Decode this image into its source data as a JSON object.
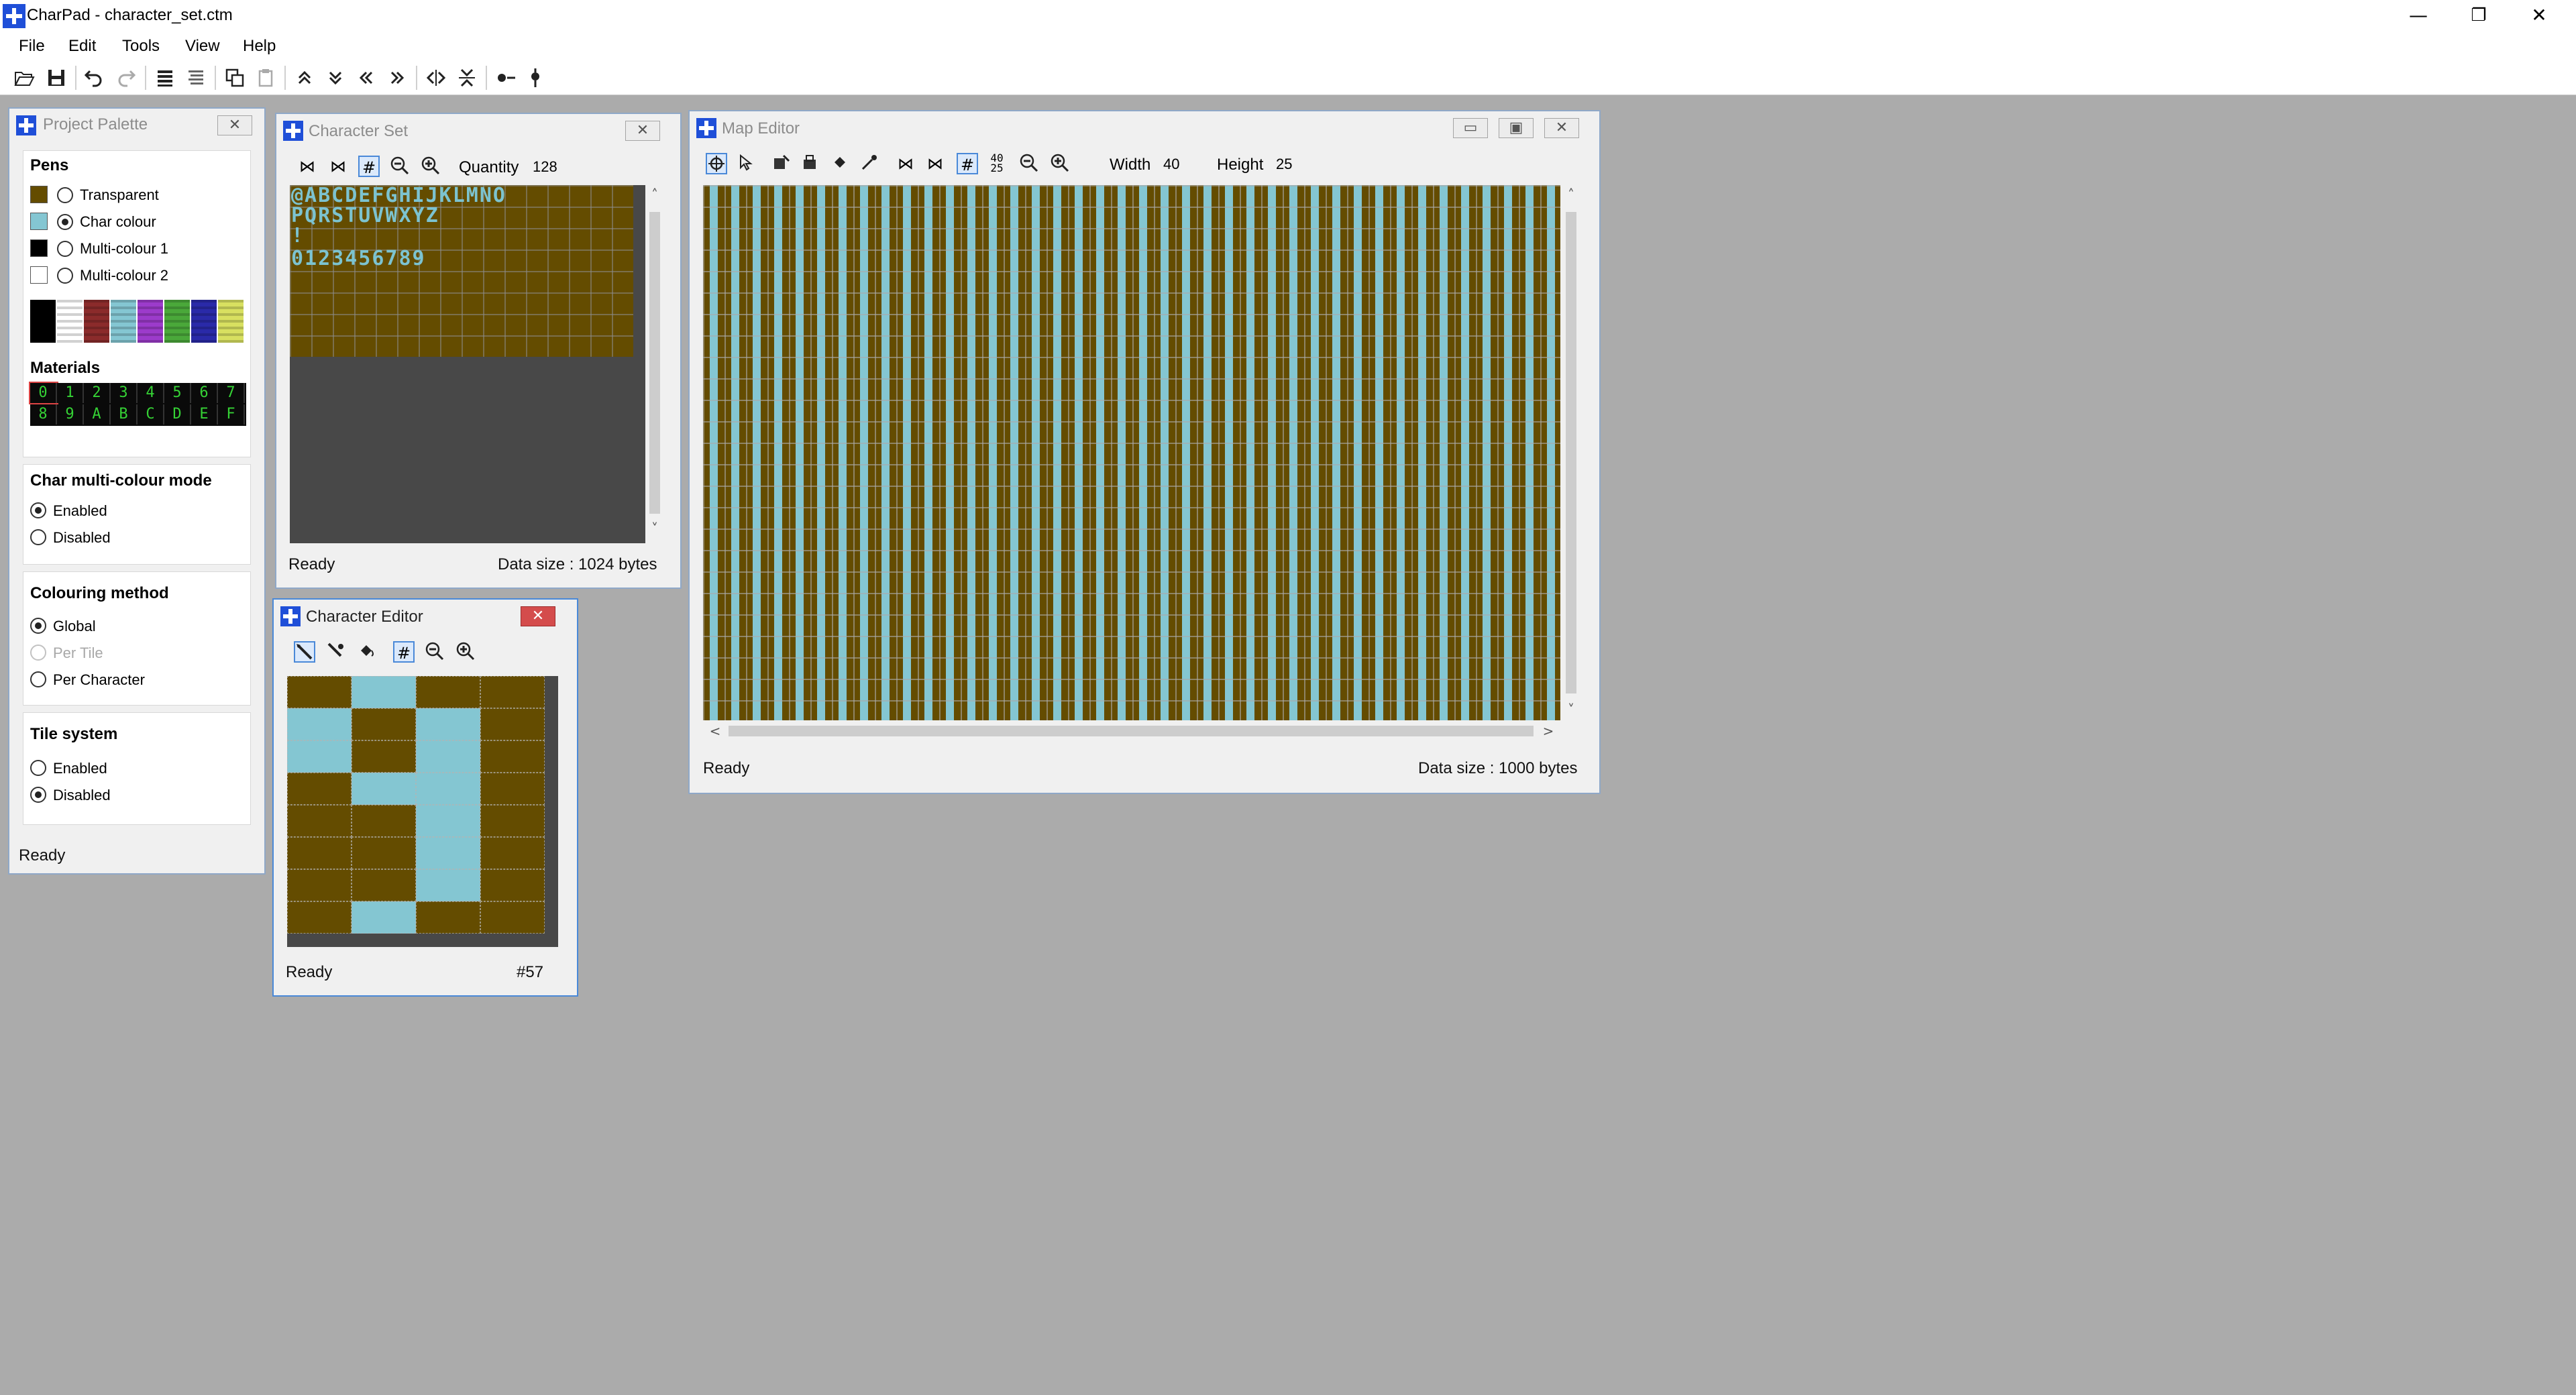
{
  "app": {
    "title": "CharPad - character_set.ctm"
  },
  "window_controls": {
    "minimize": "—",
    "restore": "❐",
    "close": "✕"
  },
  "menu": [
    "File",
    "Edit",
    "Tools",
    "View",
    "Help"
  ],
  "project_palette": {
    "title": "Project Palette",
    "pens_header": "Pens",
    "pens": [
      {
        "label": "Transparent",
        "color": "#644c00",
        "selected": false
      },
      {
        "label": "Char colour",
        "color": "#84c6d2",
        "selected": true
      },
      {
        "label": "Multi-colour 1",
        "color": "#000000",
        "selected": false
      },
      {
        "label": "Multi-colour 2",
        "color": "#ffffff",
        "selected": false
      }
    ],
    "palette_colors": [
      "#000000",
      "#ffffff",
      "#8b2b2b",
      "#84c6d2",
      "#9c3bcb",
      "#4aa83a",
      "#2a2aa8",
      "#d8e060"
    ],
    "materials_header": "Materials",
    "materials_row1": [
      "0",
      "1",
      "2",
      "3",
      "4",
      "5",
      "6",
      "7"
    ],
    "materials_row2": [
      "8",
      "9",
      "A",
      "B",
      "C",
      "D",
      "E",
      "F"
    ],
    "multicolour_header": "Char multi-colour mode",
    "multicolour_options": [
      {
        "label": "Enabled",
        "selected": true
      },
      {
        "label": "Disabled",
        "selected": false
      }
    ],
    "colouring_header": "Colouring method",
    "colouring_options": [
      {
        "label": "Global",
        "selected": true,
        "disabled": false
      },
      {
        "label": "Per Tile",
        "selected": false,
        "disabled": true
      },
      {
        "label": "Per Character",
        "selected": false,
        "disabled": false
      }
    ],
    "tile_header": "Tile system",
    "tile_options": [
      {
        "label": "Enabled",
        "selected": false
      },
      {
        "label": "Disabled",
        "selected": true
      }
    ],
    "status": "Ready"
  },
  "character_set": {
    "title": "Character Set",
    "quantity_label": "Quantity",
    "quantity_value": "128",
    "rows": [
      "@ABCDEFGHIJKLMNO",
      "PQRSTUVWXYZ",
      " !",
      "0123456789"
    ],
    "status": "Ready",
    "data_size": "Data size : 1024 bytes"
  },
  "character_editor": {
    "title": "Character Editor",
    "status": "Ready",
    "index": "#57",
    "bg_color": "#644c00",
    "fg_color": "#84c6d2"
  },
  "map_editor": {
    "title": "Map Editor",
    "width_label": "Width",
    "width_value": "40",
    "height_label": "Height",
    "height_value": "25",
    "grid_toggle_label": "40 25",
    "status": "Ready",
    "data_size": "Data size : 1000 bytes"
  },
  "icons": {
    "close_x": "✕",
    "up": "˄",
    "down": "˅",
    "left": "<",
    "right": ">"
  }
}
